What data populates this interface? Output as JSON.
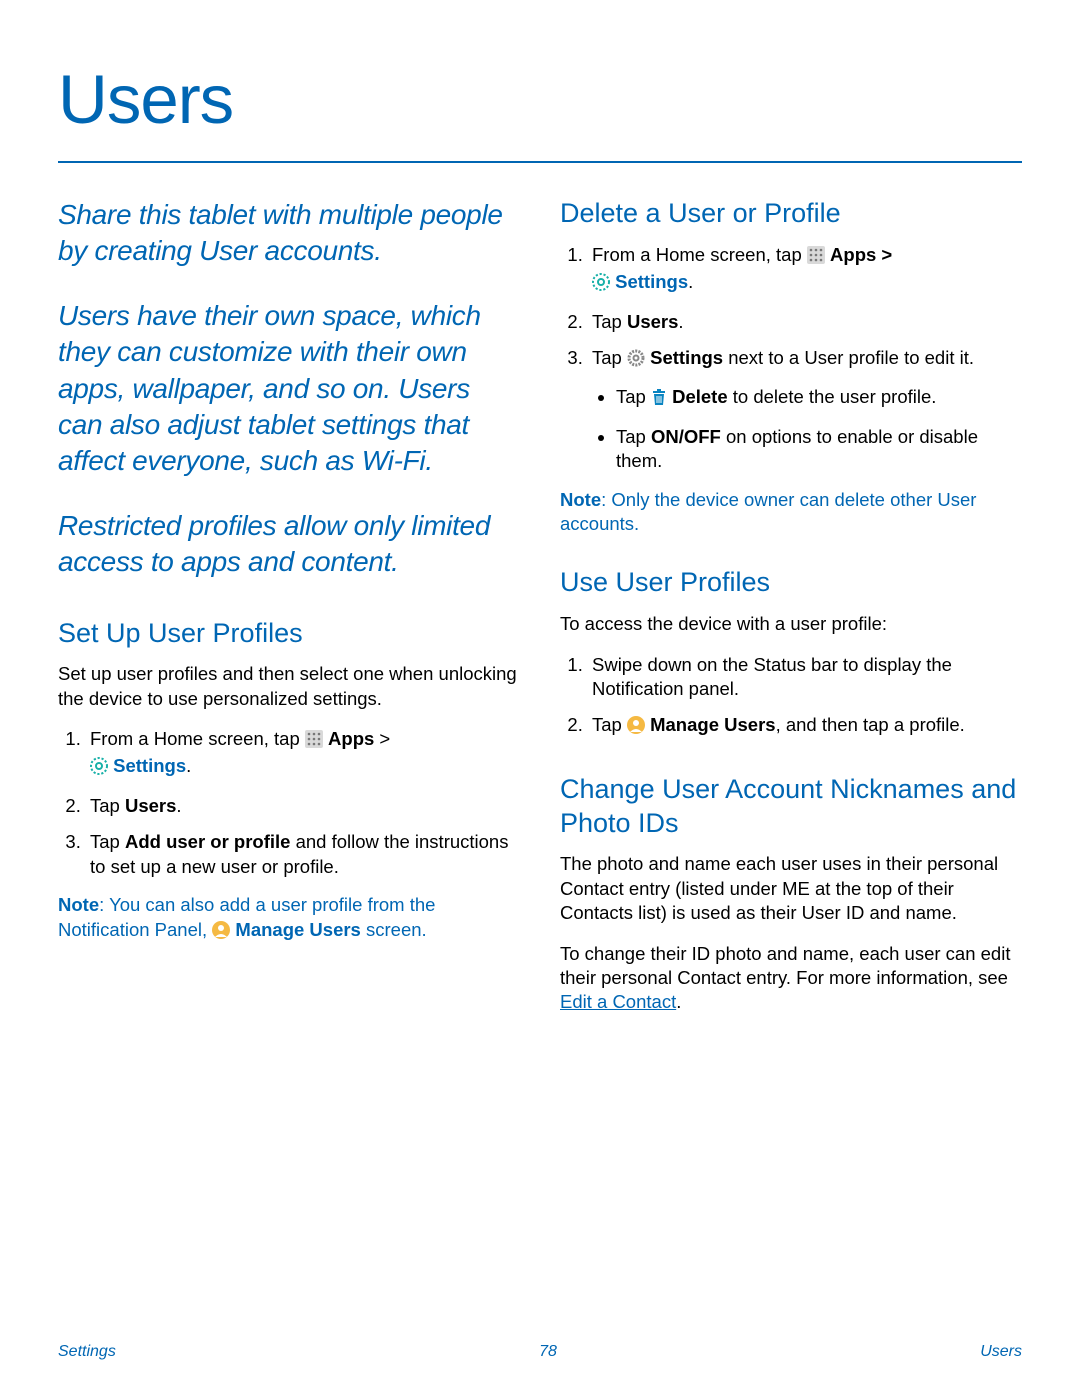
{
  "title": "Users",
  "intro": {
    "p1": "Share this tablet with multiple people by creating User accounts.",
    "p2": "Users have their own space, which they can customize with their own apps, wallpaper, and so on. Users can also adjust tablet settings that affect everyone, such as Wi-Fi.",
    "p3": "Restricted profiles allow only limited access to apps and content."
  },
  "setup": {
    "heading": "Set Up User Profiles",
    "lead": "Set up user profiles and then select one when unlocking the device to use personalized settings.",
    "s1a": "From a Home screen, tap ",
    "s1b": "Apps",
    "s1c": " > ",
    "s1d": "Settings",
    "s1e": ".",
    "s2a": "Tap ",
    "s2b": "Users",
    "s2c": ".",
    "s3a": "Tap ",
    "s3b": "Add user or profile",
    "s3c": " and follow the instructions to set up a new user or profile.",
    "note_label": "Note",
    "note_a": ": You can also add a user profile from the Notification Panel, ",
    "note_b": "Manage Users",
    "note_c": " screen."
  },
  "delete": {
    "heading": "Delete a User or Profile",
    "s1a": "From a Home screen, tap ",
    "s1b": "Apps",
    "s1c": " > ",
    "s1d": "Settings",
    "s1e": ".",
    "s2a": "Tap ",
    "s2b": "Users",
    "s2c": ".",
    "s3a": "Tap ",
    "s3b": "Settings",
    "s3c": " next to a User profile to edit it.",
    "b1a": "Tap ",
    "b1b": "Delete",
    "b1c": " to delete the user profile.",
    "b2a": "Tap ",
    "b2b": "ON/OFF",
    "b2c": " on options to enable or disable them.",
    "note_label": "Note",
    "note_a": ": Only the device owner can delete other User accounts."
  },
  "use": {
    "heading": "Use User Profiles",
    "lead": "To access the device with a user profile:",
    "s1": "Swipe down on the Status bar to display the Notification panel.",
    "s2a": "Tap ",
    "s2b": "Manage Users",
    "s2c": ", and then tap a profile."
  },
  "change": {
    "heading": "Change User Account Nicknames and Photo IDs",
    "p1": "The photo and name each user uses in their personal Contact entry (listed under ME at the top of their Contacts list) is used as their User ID and name.",
    "p2a": "To change their ID photo and name, each user can edit their personal Contact entry. For more information, see ",
    "p2b": "Edit a Contact",
    "p2c": "."
  },
  "footer": {
    "left": "Settings",
    "center": "78",
    "right": "Users"
  }
}
